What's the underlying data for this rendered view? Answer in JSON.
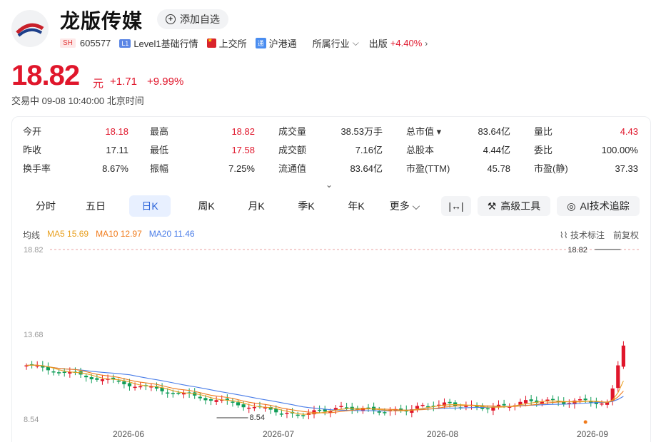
{
  "header": {
    "title": "龙版传媒",
    "add_watchlist": "添加自选",
    "market_tag": "SH",
    "code": "605577",
    "level_tag": "L1",
    "level_text": "Level1基础行情",
    "exchange": "上交所",
    "connect_tag": "通",
    "connect": "沪港通",
    "industry_label": "所属行业",
    "sector": "出版",
    "sector_change": "+4.40%"
  },
  "quote": {
    "price": "18.82",
    "unit": "元",
    "change": "+1.71",
    "change_pct": "+9.99%",
    "status": "交易中  09-08 10:40:00  北京时间"
  },
  "stats": [
    {
      "label": "今开",
      "value": "18.18",
      "color": "red"
    },
    {
      "label": "最高",
      "value": "18.82",
      "color": "red"
    },
    {
      "label": "成交量",
      "value": "38.53万手"
    },
    {
      "label": "总市值",
      "value": "83.64亿",
      "has_dropdown": true
    },
    {
      "label": "量比",
      "value": "4.43",
      "color": "red"
    },
    {
      "label": "昨收",
      "value": "17.11"
    },
    {
      "label": "最低",
      "value": "17.58",
      "color": "red"
    },
    {
      "label": "成交额",
      "value": "7.16亿"
    },
    {
      "label": "总股本",
      "value": "4.44亿"
    },
    {
      "label": "委比",
      "value": "100.00%"
    },
    {
      "label": "换手率",
      "value": "8.67%"
    },
    {
      "label": "振幅",
      "value": "7.25%"
    },
    {
      "label": "流通值",
      "value": "83.64亿"
    },
    {
      "label": "市盈(TTM)",
      "value": "45.78"
    },
    {
      "label": "市盈(静)",
      "value": "37.33"
    }
  ],
  "tabs": [
    "分时",
    "五日",
    "日K",
    "周K",
    "月K",
    "季K",
    "年K",
    "更多"
  ],
  "active_tab": "日K",
  "tools": {
    "advanced": "高级工具",
    "ai": "AI技术追踪"
  },
  "legend": {
    "lead": "均线",
    "ma5": "MA5 15.69",
    "ma10": "MA10 12.97",
    "ma20": "MA20 11.46"
  },
  "chart_options": {
    "annotation": "技术标注",
    "adjust": "前复权"
  },
  "chart_data": {
    "type": "candlestick",
    "y_ticks": [
      "18.82",
      "13.68",
      "8.54"
    ],
    "ylim": [
      8.54,
      18.82
    ],
    "x_labels": [
      "2026-06",
      "2026-07",
      "2026-08",
      "2026-09"
    ],
    "max_label": "18.82",
    "min_label": "8.54",
    "colors": {
      "up": "#e0162b",
      "down": "#0f9d58",
      "ma5": "#e8a020",
      "ma10": "#f07a1a",
      "ma20": "#4a7de8"
    }
  }
}
